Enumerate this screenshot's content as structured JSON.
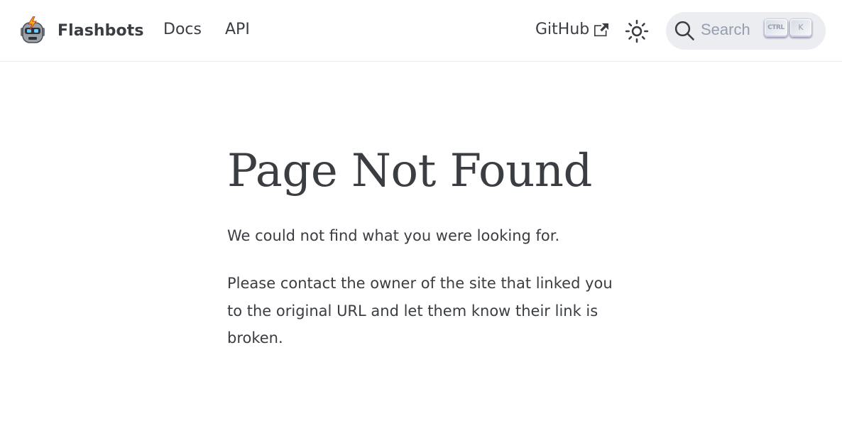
{
  "navbar": {
    "brand": "Flashbots",
    "links": [
      "Docs",
      "API"
    ],
    "github": "GitHub",
    "search_placeholder": "Search",
    "search_keys": [
      "CTRL",
      "K"
    ]
  },
  "page": {
    "title": "Page Not Found",
    "paragraphs": [
      "We could not find what you were looking for.",
      "Please contact the owner of the site that linked you to the original URL and let them know their link is broken."
    ]
  },
  "icons": {
    "logo": "robot-logo-icon",
    "external": "external-link-icon",
    "theme": "sun-icon",
    "search": "search-icon"
  },
  "colors": {
    "text": "#3a3d42",
    "search_bg": "#ebedf0",
    "search_text": "#969faf"
  }
}
